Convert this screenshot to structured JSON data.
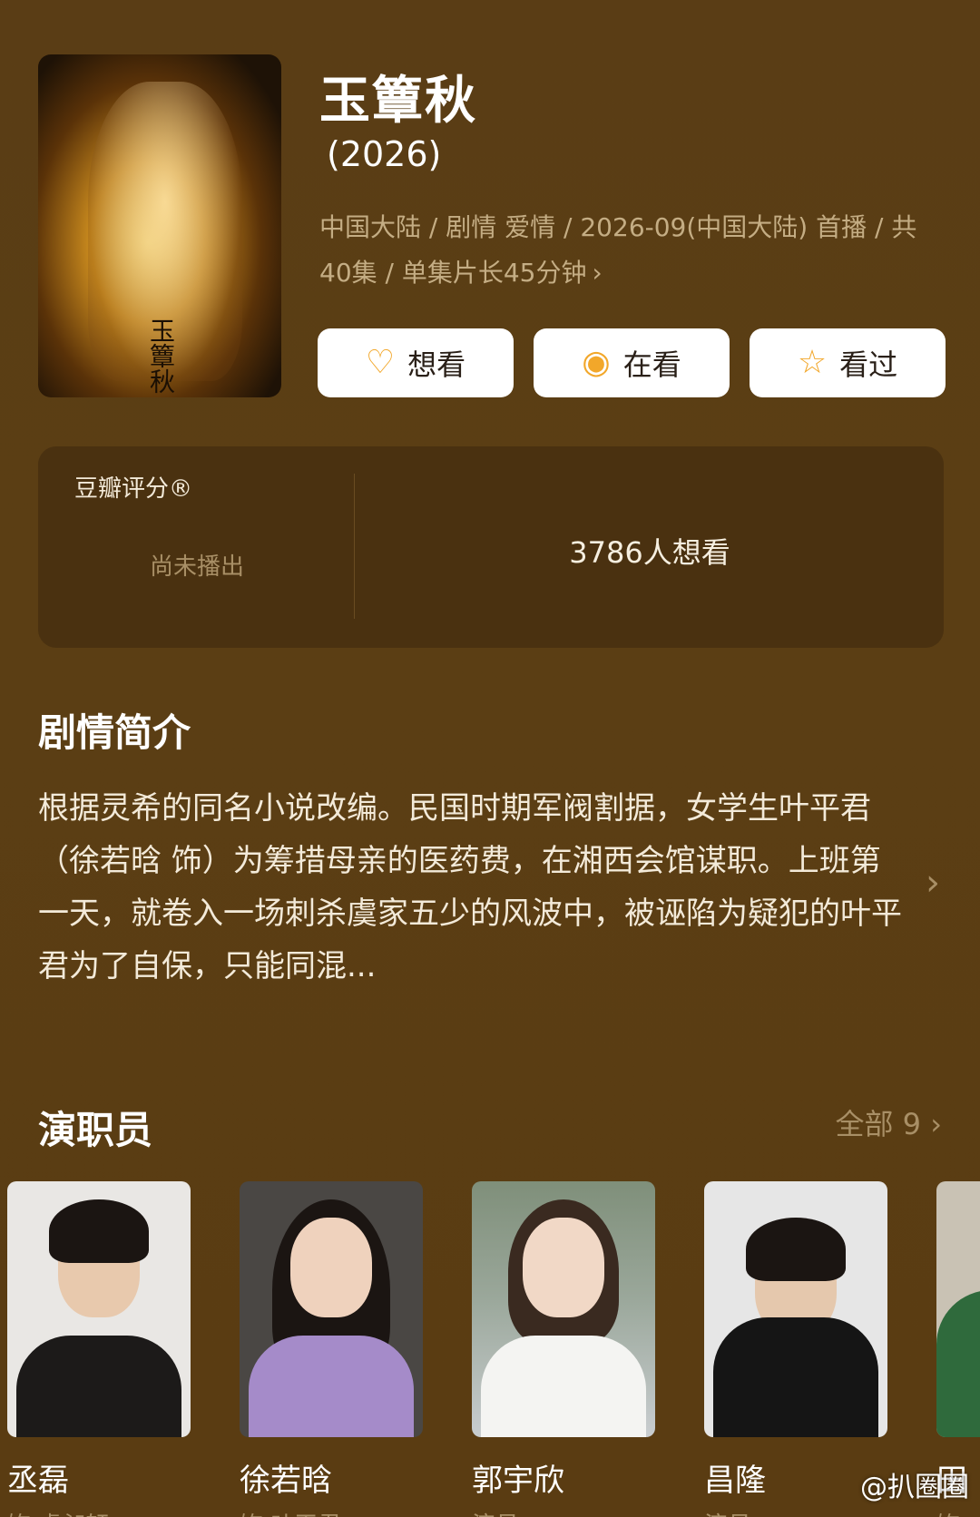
{
  "show": {
    "title": "玉簟秋",
    "year": "(2026)",
    "meta_line1": "中国大陆 / 剧情 爱情 / 2026-09(中国大陆) 首播 / 共",
    "meta_line2": "40集 / 单集片长45分钟",
    "poster_text": "玉簟秋"
  },
  "actions": [
    {
      "label": "想看",
      "icon": "heart-plus-icon"
    },
    {
      "label": "在看",
      "icon": "target-circle-icon"
    },
    {
      "label": "看过",
      "icon": "star-icon"
    }
  ],
  "rating": {
    "label": "豆瓣评分®",
    "status": "尚未播出",
    "want_count": "3786人想看"
  },
  "synopsis": {
    "heading": "剧情简介",
    "text": "根据灵希的同名小说改编。民国时期军阀割据，女学生叶平君（徐若晗 饰）为筹措母亲的医药费，在湘西会馆谋职。上班第一天，就卷入一场刺杀虞家五少的风波中，被诬陷为疑犯的叶平君为了自保，只能同混..."
  },
  "cast": {
    "heading": "演职员",
    "all_label": "全部 9",
    "members": [
      {
        "name": "丞磊",
        "role": "饰 虞昶轩"
      },
      {
        "name": "徐若晗",
        "role": "饰 叶平君"
      },
      {
        "name": "郭宇欣",
        "role": "演员"
      },
      {
        "name": "昌隆",
        "role": "演员"
      },
      {
        "name": "田",
        "role": "饰"
      }
    ]
  },
  "watermark": "@扒圈圈",
  "colors": {
    "background": "#5a3d15",
    "card": "#4a3110",
    "accent": "#f2a72a",
    "muted": "#a88f66"
  }
}
